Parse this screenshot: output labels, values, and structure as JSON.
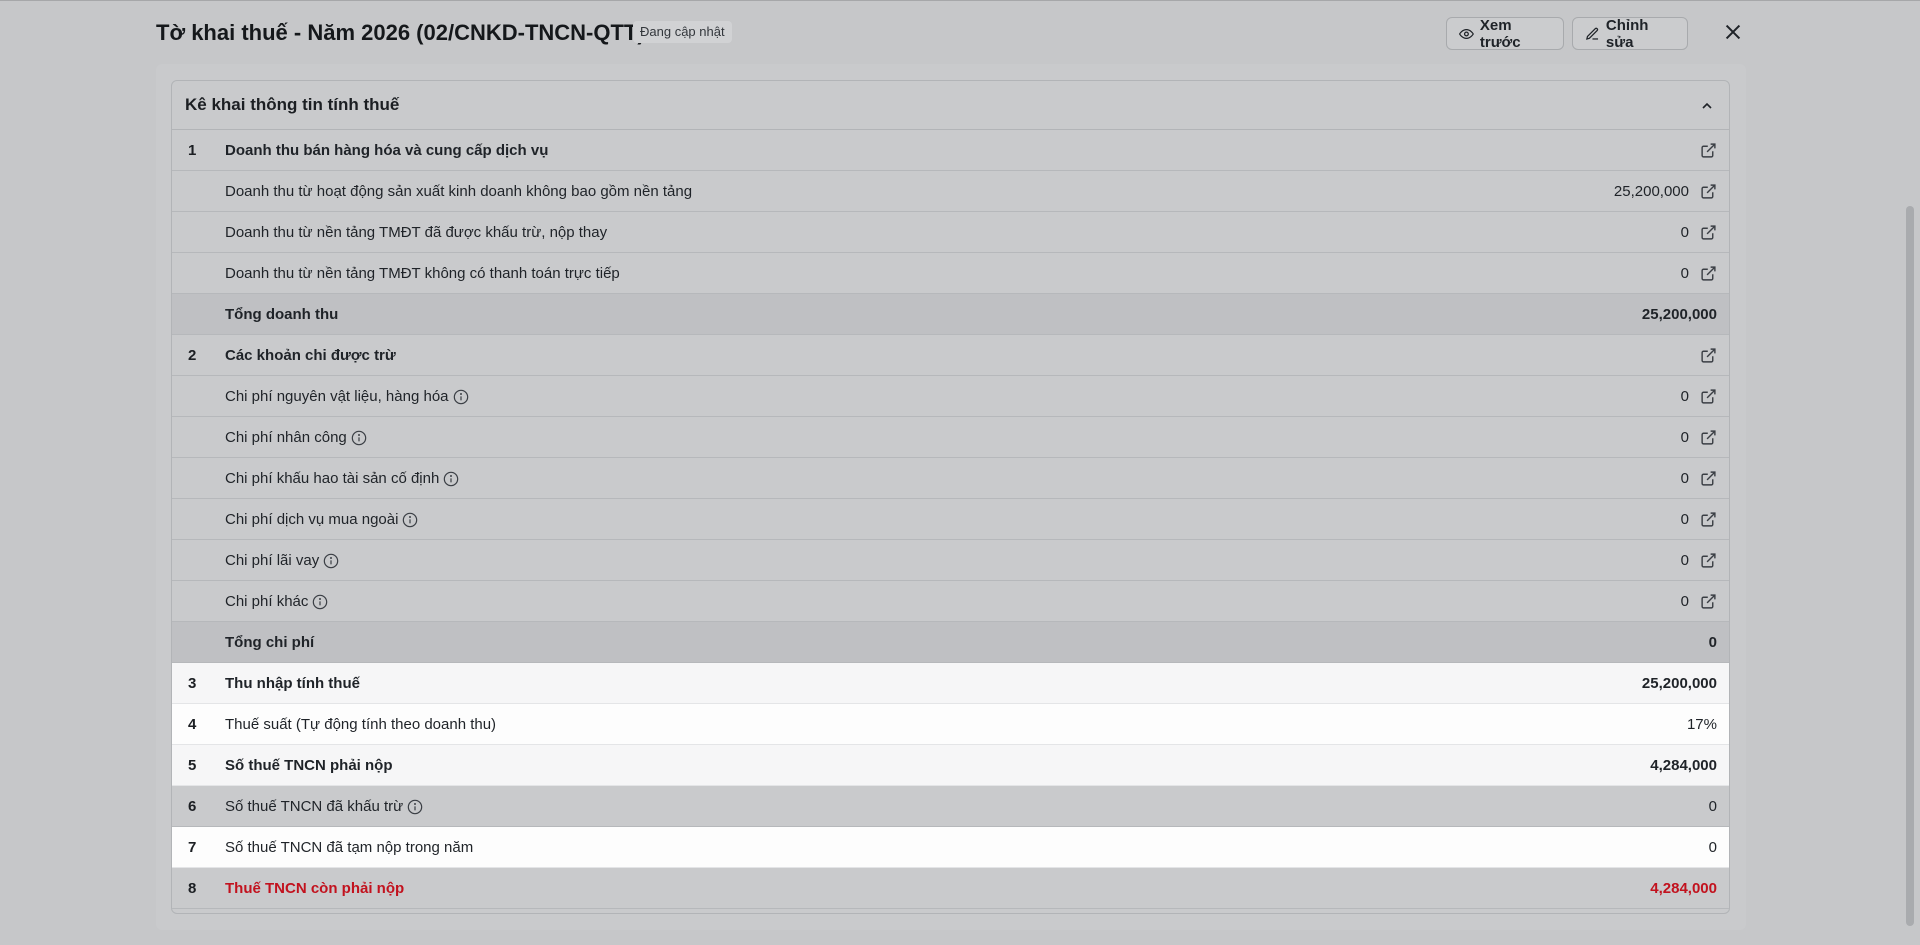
{
  "header": {
    "title": "Tờ khai thuế - Năm 2026 (02/CNKD-TNCN-QTT)",
    "badge": "Đang cập nhật",
    "preview_label": "Xem trước",
    "edit_label": "Chỉnh sửa"
  },
  "section": {
    "title": "Kê khai thông tin tính thuế"
  },
  "rows": [
    {
      "num": "1",
      "label": "Doanh thu bán hàng hóa và cung cấp dịch vụ",
      "value": ""
    },
    {
      "num": "",
      "label": "Doanh thu từ hoạt động sản xuất kinh doanh không bao gồm nền tảng",
      "value": "25,200,000"
    },
    {
      "num": "",
      "label": "Doanh thu từ nền tảng TMĐT đã được khấu trừ, nộp thay",
      "value": "0"
    },
    {
      "num": "",
      "label": "Doanh thu từ nền tảng TMĐT không có thanh toán trực tiếp",
      "value": "0"
    },
    {
      "num": "",
      "label": "Tổng doanh thu",
      "value": "25,200,000"
    },
    {
      "num": "2",
      "label": "Các khoản chi được trừ",
      "value": ""
    },
    {
      "num": "",
      "label": "Chi phí nguyên vật liệu, hàng hóa",
      "value": "0"
    },
    {
      "num": "",
      "label": "Chi phí nhân công",
      "value": "0"
    },
    {
      "num": "",
      "label": "Chi phí khấu hao tài sản cố định",
      "value": "0"
    },
    {
      "num": "",
      "label": "Chi phí dịch vụ mua ngoài",
      "value": "0"
    },
    {
      "num": "",
      "label": "Chi phí lãi vay",
      "value": "0"
    },
    {
      "num": "",
      "label": "Chi phí khác",
      "value": "0"
    },
    {
      "num": "",
      "label": "Tổng chi phí",
      "value": "0"
    },
    {
      "num": "3",
      "label": "Thu nhập tính thuế",
      "value": "25,200,000"
    },
    {
      "num": "4",
      "label": "Thuế suất (Tự động tính theo doanh thu)",
      "value": "17%"
    },
    {
      "num": "5",
      "label": "Số thuế TNCN phải nộp",
      "value": "4,284,000"
    },
    {
      "num": "6",
      "label": "Số thuế TNCN đã khấu trừ",
      "value": "0"
    },
    {
      "num": "7",
      "label": "Số thuế TNCN đã tạm nộp trong năm",
      "value": "0"
    },
    {
      "num": "8",
      "label": "Thuế TNCN còn phải nộp",
      "value": "4,284,000"
    }
  ],
  "colors": {
    "accent_red": "#c2121e",
    "overlay": "#c6c7c9"
  },
  "icons": {
    "preview": "eye-icon",
    "edit": "pencil-icon",
    "close": "close-icon",
    "collapse": "chevron-up-icon",
    "link": "external-link-icon",
    "info": "info-icon"
  }
}
